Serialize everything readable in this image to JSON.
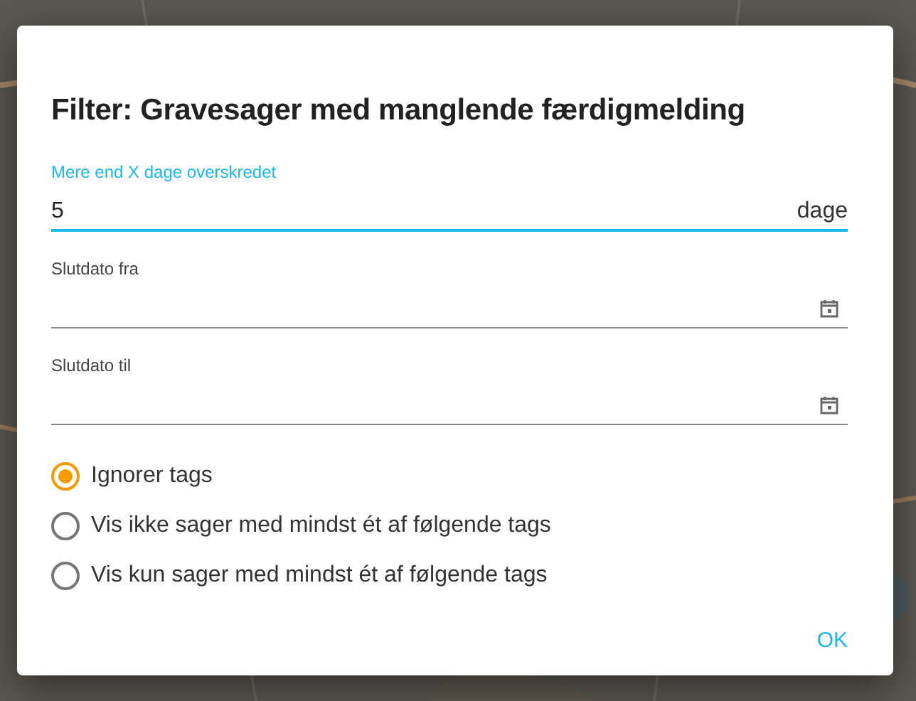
{
  "dialog": {
    "title": "Filter: Gravesager med manglende færdigmelding",
    "fields": [
      {
        "kind": "number",
        "label": "Mere end X dage overskredet",
        "value": "5",
        "suffix": "dage",
        "focused": true
      },
      {
        "kind": "date",
        "label": "Slutdato fra",
        "focused": false
      },
      {
        "kind": "date",
        "label": "Slutdato til",
        "focused": false
      }
    ],
    "tag_options": [
      {
        "label": "Ignorer tags",
        "selected": true
      },
      {
        "label": "Vis ikke sager med mindst ét af følgende tags",
        "selected": false
      },
      {
        "label": "Vis kun sager med mindst ét af følgende tags",
        "selected": false
      }
    ],
    "buttons": [
      "OK"
    ]
  }
}
